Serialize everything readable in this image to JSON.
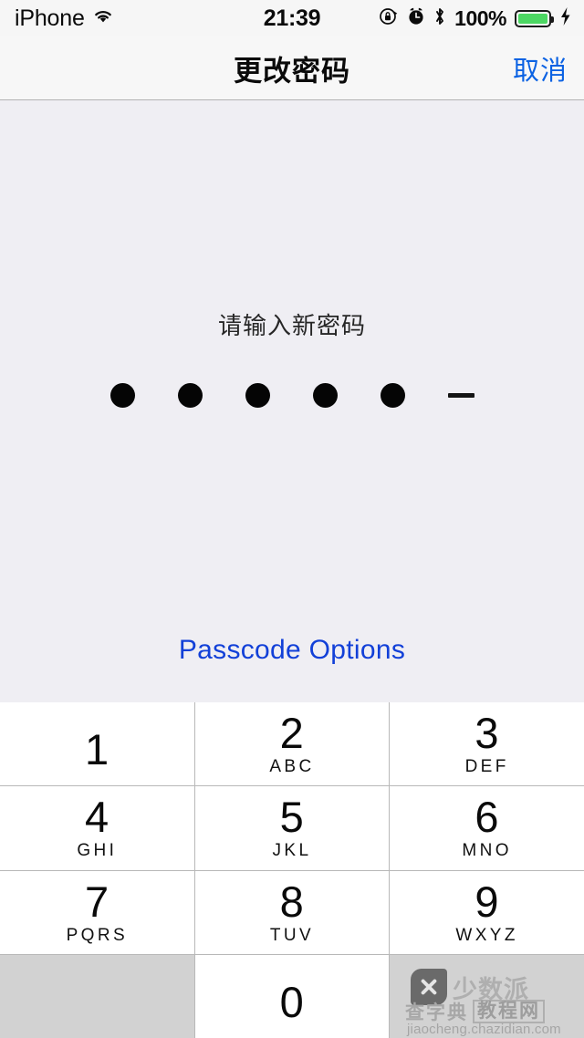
{
  "status_bar": {
    "carrier": "iPhone",
    "wifi_icon": "wifi-icon",
    "time": "21:39",
    "rotation_lock_icon": "rotation-lock-icon",
    "alarm_icon": "alarm-clock-icon",
    "bluetooth_icon": "bluetooth-icon",
    "battery_percent": "100%",
    "battery_fill_color": "#4cd763",
    "charging_icon": "lightning-bolt-icon"
  },
  "nav_bar": {
    "title": "更改密码",
    "cancel_label": "取消",
    "cancel_color": "#0b62e3"
  },
  "content": {
    "prompt": "请输入新密码",
    "passcode": {
      "length": 6,
      "entered": 5,
      "slots": [
        "filled",
        "filled",
        "filled",
        "filled",
        "filled",
        "empty"
      ]
    },
    "passcode_options_label": "Passcode Options",
    "passcode_options_color": "#1240d8"
  },
  "keypad": {
    "keys": [
      {
        "digit": "1",
        "letters": ""
      },
      {
        "digit": "2",
        "letters": "ABC"
      },
      {
        "digit": "3",
        "letters": "DEF"
      },
      {
        "digit": "4",
        "letters": "GHI"
      },
      {
        "digit": "5",
        "letters": "JKL"
      },
      {
        "digit": "6",
        "letters": "MNO"
      },
      {
        "digit": "7",
        "letters": "PQRS"
      },
      {
        "digit": "8",
        "letters": "TUV"
      },
      {
        "digit": "9",
        "letters": "WXYZ"
      },
      {
        "digit": "",
        "letters": ""
      },
      {
        "digit": "0",
        "letters": ""
      },
      {
        "digit": "",
        "letters": ""
      }
    ]
  },
  "watermark": {
    "brand": "少数派",
    "site": "查字典",
    "tag": "教程网",
    "url": "jiaocheng.chazidian.com"
  }
}
